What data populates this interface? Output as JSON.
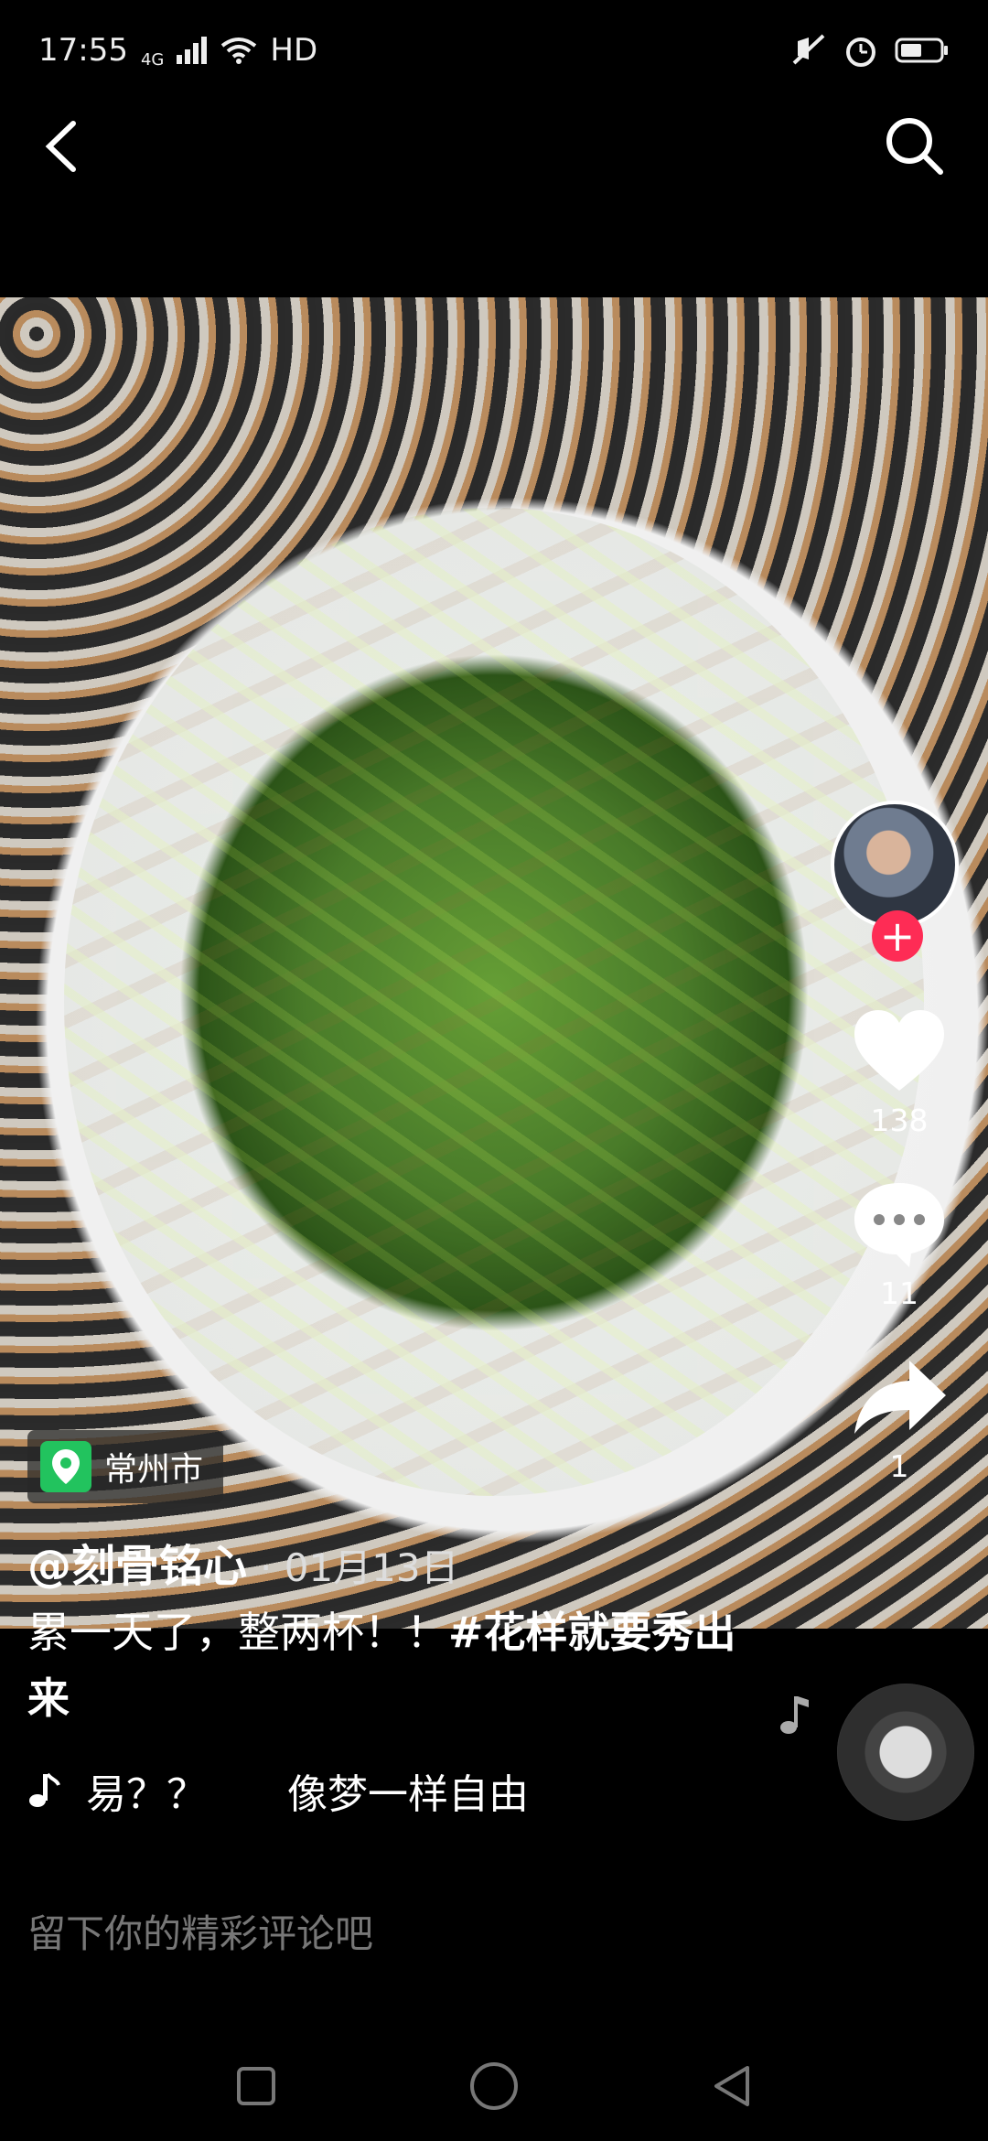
{
  "status_bar": {
    "time": "17:55",
    "network_label": "4G",
    "hd_label": "HD",
    "icons": [
      "signal-icon",
      "wifi-icon",
      "mute-icon",
      "alarm-icon",
      "battery-icon"
    ]
  },
  "top_nav": {
    "back_icon": "back-arrow-icon",
    "search_icon": "search-icon"
  },
  "video": {
    "description_icon": "food-photo"
  },
  "right_rail": {
    "avatar_icon": "avatar",
    "follow_symbol": "+",
    "like_count": "138",
    "comment_count": "11",
    "share_count": "1",
    "accent_color": "#fe2c55"
  },
  "location": {
    "text": "常州市",
    "icon": "location-pin-icon",
    "color": "#22c35e"
  },
  "author": {
    "name": "@刻骨铭心",
    "date": "· 01月13日"
  },
  "caption": {
    "text": "累一天了，整两杯！！",
    "hashtag": "#花样就要秀出来"
  },
  "music": {
    "text": "易？？　　像梦一样自由",
    "icon": "music-note-icon"
  },
  "comment": {
    "placeholder": "留下你的精彩评论吧"
  },
  "nav_bar": {
    "buttons": [
      "recent-apps-button",
      "home-button",
      "back-button"
    ]
  }
}
